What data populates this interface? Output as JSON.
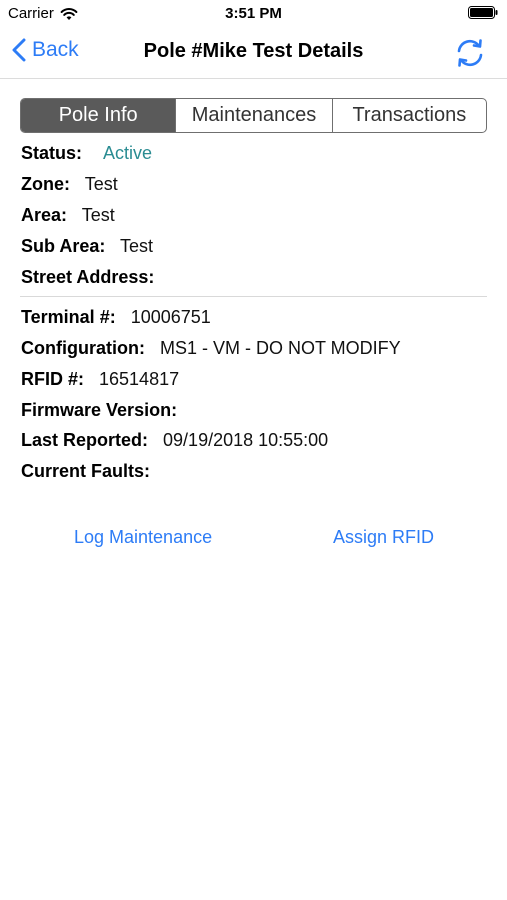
{
  "status_bar": {
    "carrier": "Carrier",
    "time": "3:51 PM"
  },
  "nav": {
    "back_label": "Back",
    "title": "Pole #Mike Test Details"
  },
  "tabs": [
    {
      "label": "Pole Info",
      "selected": true
    },
    {
      "label": "Maintenances",
      "selected": false
    },
    {
      "label": "Transactions",
      "selected": false
    }
  ],
  "pole_info": {
    "status": {
      "label": "Status:",
      "value": "Active"
    },
    "zone": {
      "label": "Zone:",
      "value": "Test"
    },
    "area": {
      "label": "Area:",
      "value": "Test"
    },
    "sub_area": {
      "label": "Sub Area:",
      "value": "Test"
    },
    "street_address": {
      "label": "Street Address:",
      "value": ""
    },
    "terminal": {
      "label": "Terminal #:",
      "value": "10006751"
    },
    "configuration": {
      "label": "Configuration:",
      "value": "MS1 - VM - DO NOT MODIFY"
    },
    "rfid": {
      "label": "RFID #:",
      "value": "16514817"
    },
    "firmware_version": {
      "label": "Firmware Version:",
      "value": ""
    },
    "last_reported": {
      "label": "Last Reported:",
      "value": "09/19/2018 10:55:00"
    },
    "current_faults": {
      "label": "Current Faults:",
      "value": ""
    }
  },
  "actions": {
    "log_maintenance": "Log Maintenance",
    "assign_rfid": "Assign RFID"
  },
  "colors": {
    "accent": "#2d7cf6",
    "active_status": "#2a8c92",
    "segment_selected": "#5a5a5a"
  },
  "icons": {
    "wifi": "wifi-icon",
    "battery": "battery-icon",
    "back": "chevron-left-icon",
    "refresh": "refresh-icon"
  }
}
